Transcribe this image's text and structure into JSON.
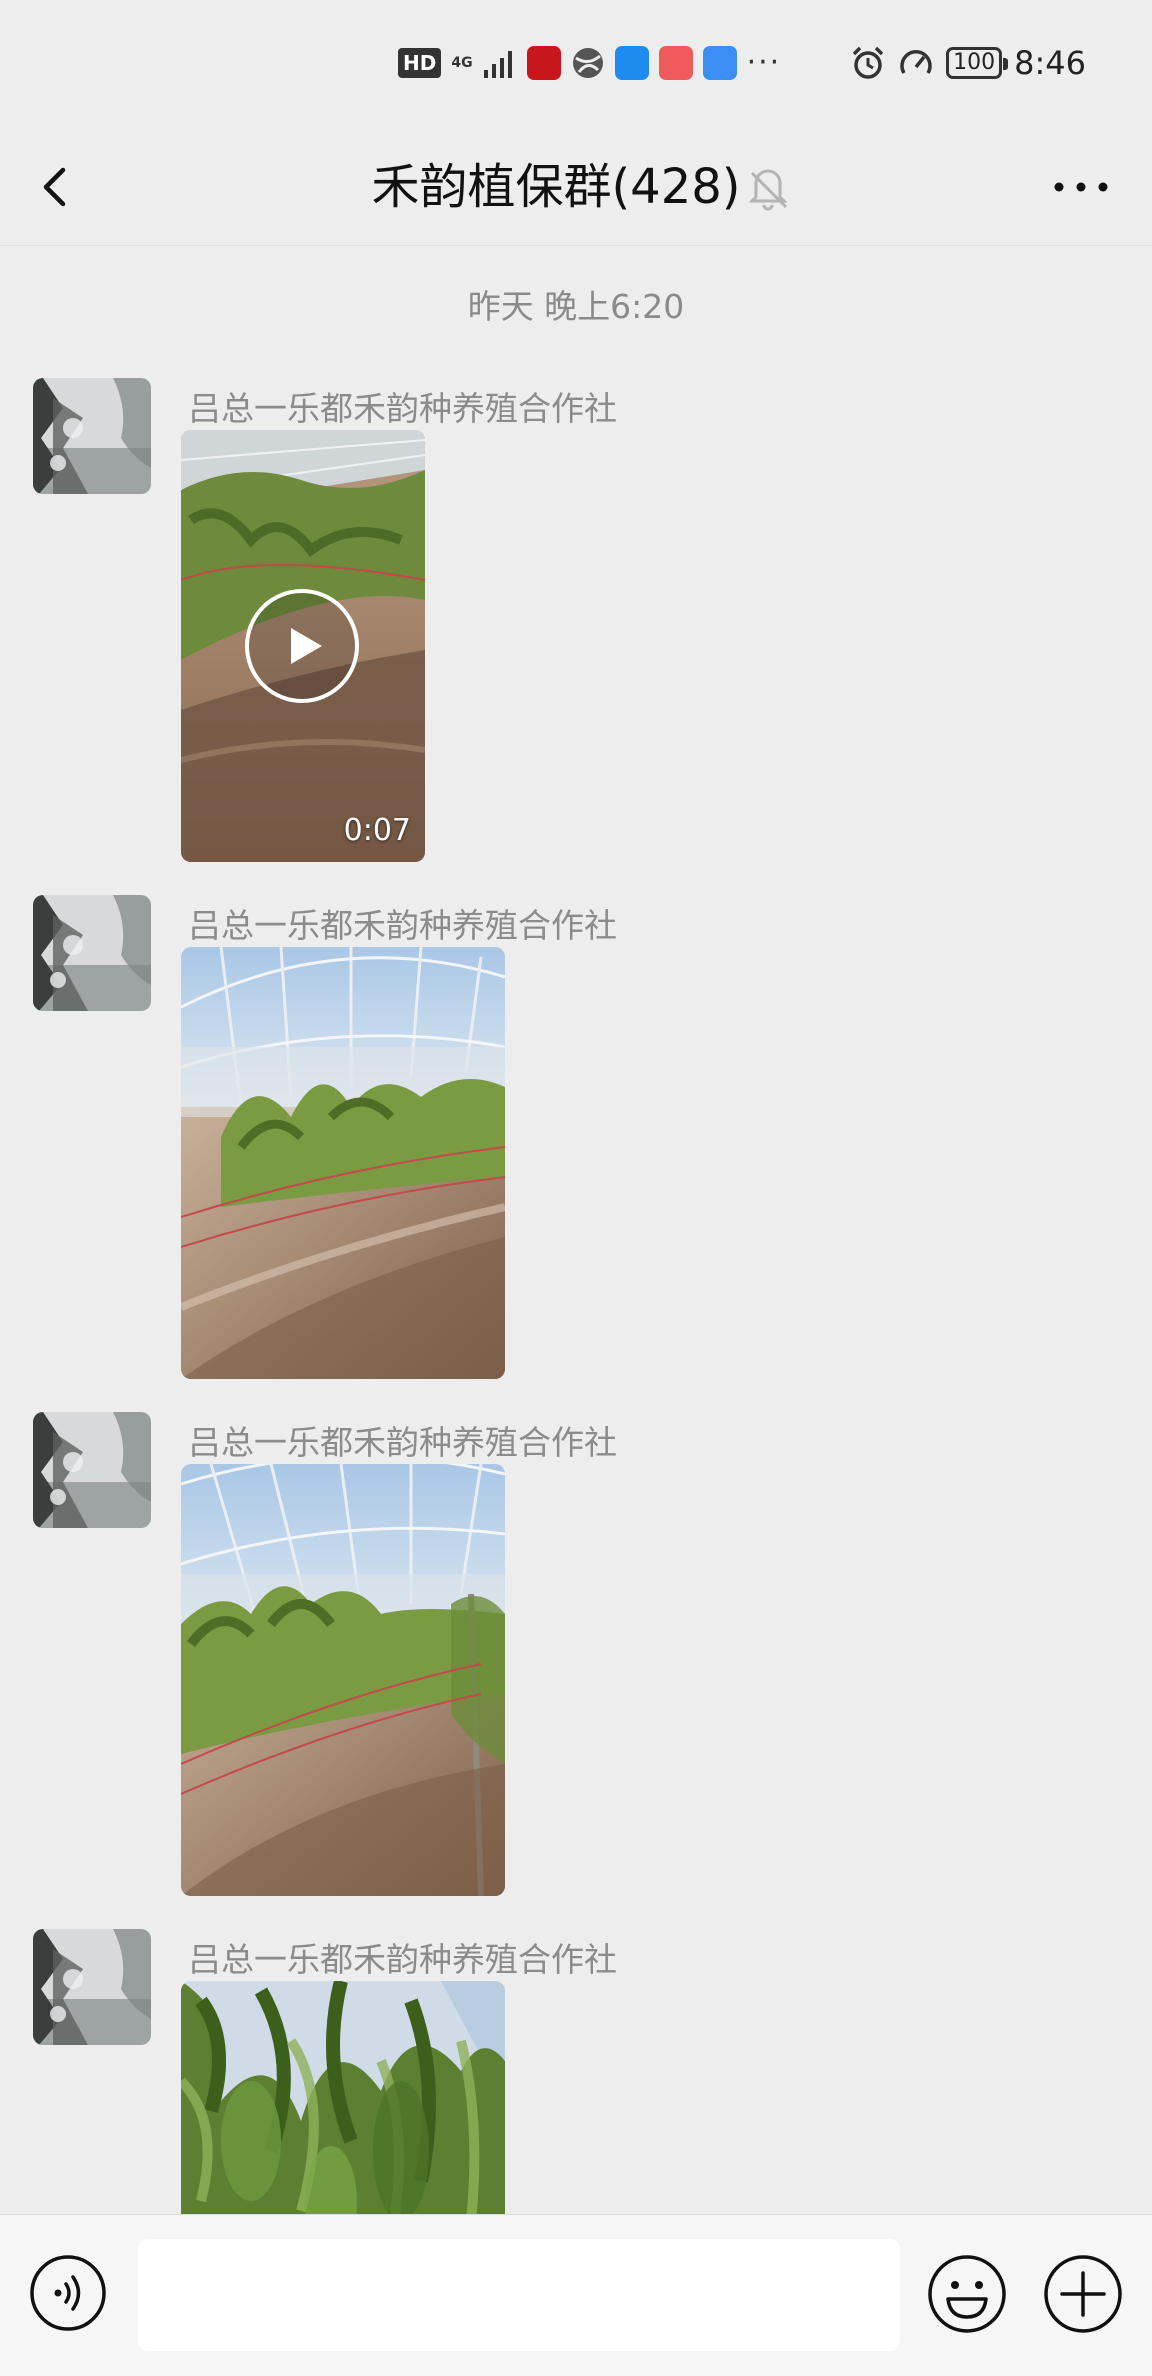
{
  "status_bar": {
    "hd": "HD",
    "network": "4G",
    "dots": "···",
    "battery": "100",
    "time": "8:46"
  },
  "nav": {
    "title": "禾韵植保群(428)",
    "back_icon": "chevron-left-icon",
    "mute_icon": "bell-off-icon",
    "more_icon": "more-dots-icon"
  },
  "chat": {
    "timestamp": "昨天 晚上6:20",
    "messages": [
      {
        "sender": "吕总一乐都禾韵种养殖合作社",
        "type": "video",
        "duration": "0:07"
      },
      {
        "sender": "吕总一乐都禾韵种养殖合作社",
        "type": "image"
      },
      {
        "sender": "吕总一乐都禾韵种养殖合作社",
        "type": "image"
      },
      {
        "sender": "吕总一乐都禾韵种养殖合作社",
        "type": "image"
      }
    ]
  },
  "input_bar": {
    "voice_icon": "voice-icon",
    "input_value": "",
    "emoji_icon": "emoji-icon",
    "plus_icon": "plus-icon"
  },
  "colors": {
    "background": "#ededed",
    "input_bar": "#f6f6f6",
    "sender_text": "#8b8b8b",
    "timestamp_text": "#8a8a8a"
  }
}
